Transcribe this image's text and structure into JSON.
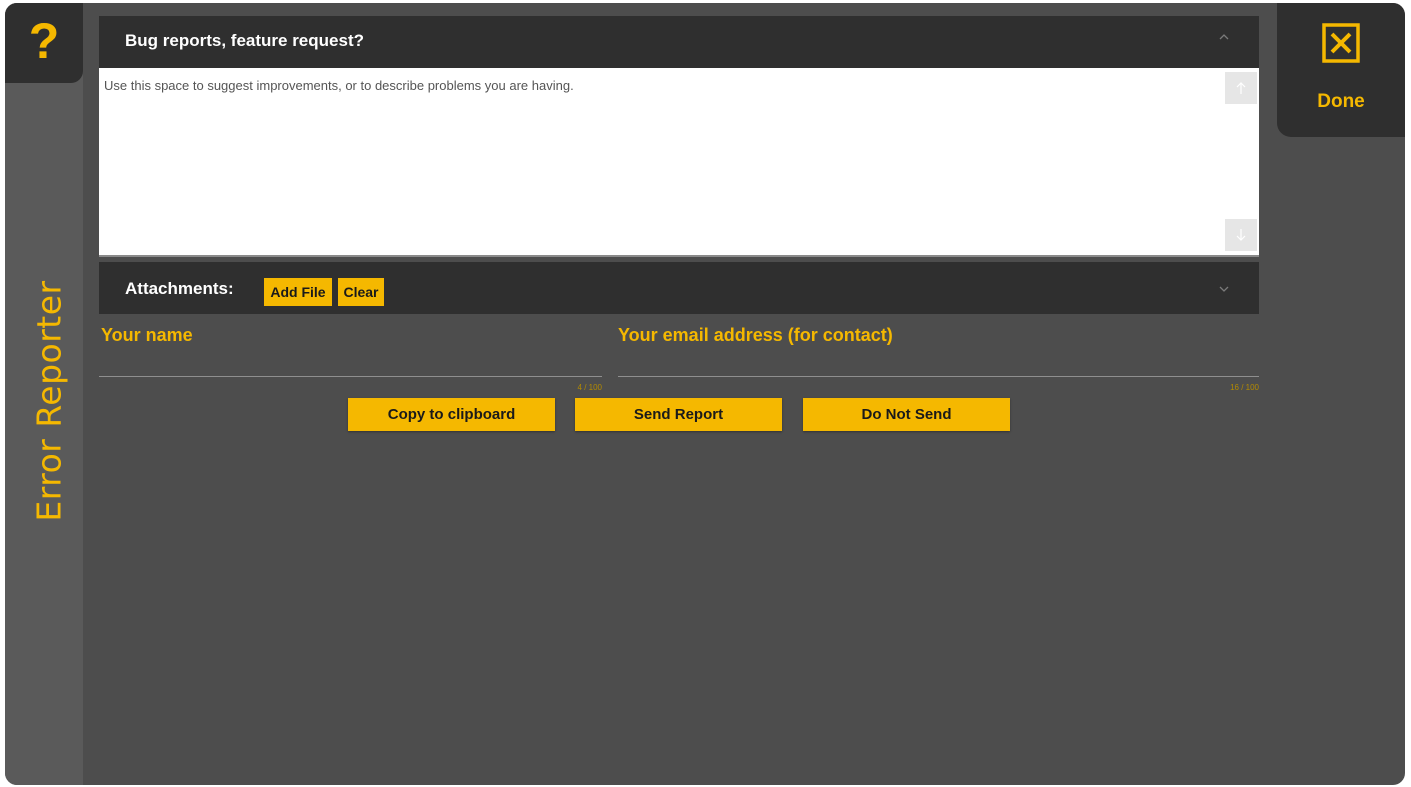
{
  "sidebar": {
    "help_glyph": "?",
    "title": "Error Reporter"
  },
  "done": {
    "label": "Done",
    "icon": "close-box-icon"
  },
  "bug_panel": {
    "title": "Bug reports, feature request?",
    "collapse_icon": "chevron-up-icon",
    "placeholder": "Use this space to suggest improvements, or to describe problems you are having."
  },
  "attachments": {
    "title": "Attachments:",
    "add_file_label": "Add File",
    "clear_label": "Clear",
    "expand_icon": "chevron-down-icon"
  },
  "fields": {
    "name_label": "Your name",
    "name_counter": "4 / 100",
    "email_label": "Your email address (for contact)",
    "email_counter": "16 / 100"
  },
  "actions": {
    "copy_label": "Copy to clipboard",
    "send_label": "Send Report",
    "dont_send_label": "Do Not Send"
  },
  "colors": {
    "accent": "#f5b800",
    "panel": "#2f2f2f",
    "background": "#4d4d4d",
    "rail": "#5a5a5a"
  }
}
